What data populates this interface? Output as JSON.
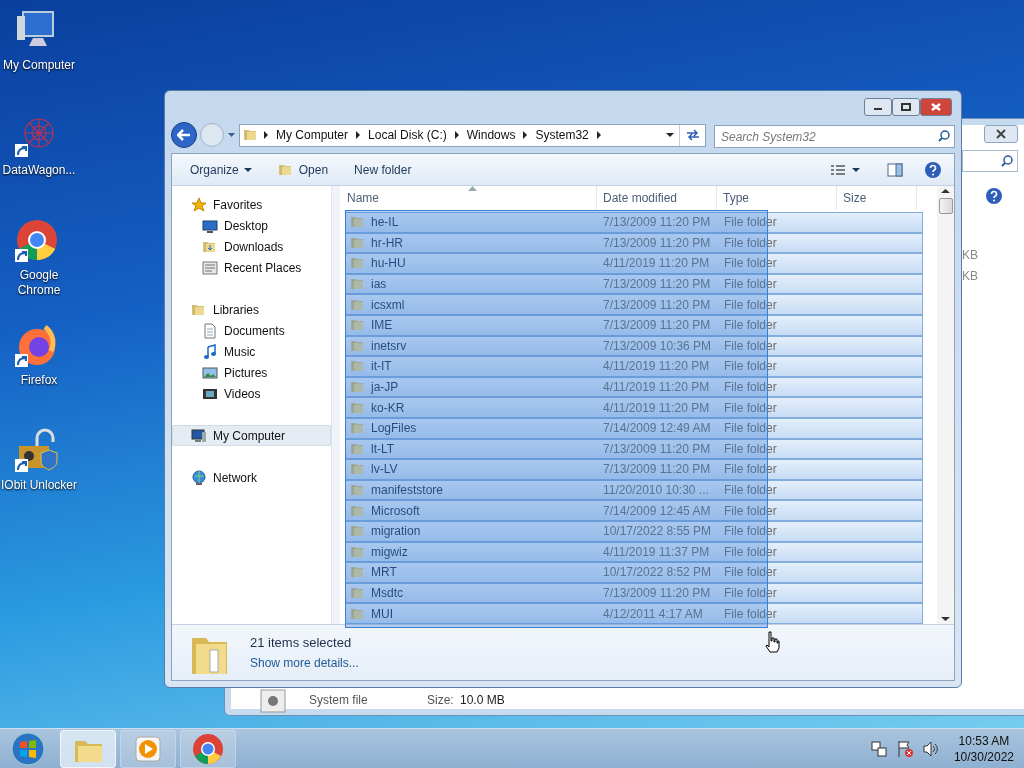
{
  "desktop_icons": [
    {
      "label": "My Computer",
      "kind": "computer",
      "shortcut": false
    },
    {
      "label": "DataWagon...",
      "kind": "web",
      "shortcut": true
    },
    {
      "label": "Google Chrome",
      "kind": "chrome",
      "shortcut": true
    },
    {
      "label": "Firefox",
      "kind": "firefox",
      "shortcut": true
    },
    {
      "label": "IObit Unlocker",
      "kind": "unlock",
      "shortcut": true
    }
  ],
  "background_window": {
    "side_texts": [
      "KB",
      "KB"
    ],
    "file_type": "System file",
    "size_label": "Size:",
    "size_value": "10.0 MB"
  },
  "window": {
    "address": [
      "My Computer",
      "Local Disk (C:)",
      "Windows",
      "System32"
    ],
    "search": {
      "placeholder": "Search System32"
    },
    "toolbar": [
      {
        "label": "Organize",
        "kind": "menu"
      },
      {
        "label": "Open",
        "kind": "open"
      },
      {
        "label": "New folder",
        "kind": "plain"
      }
    ],
    "nav": [
      {
        "label": "Favorites",
        "kind": "star",
        "selected": false,
        "children": [
          {
            "label": "Desktop",
            "kind": "desktop",
            "selected": false
          },
          {
            "label": "Downloads",
            "kind": "downloads",
            "selected": false
          },
          {
            "label": "Recent Places",
            "kind": "recent",
            "selected": false
          }
        ]
      },
      {
        "label": "Libraries",
        "kind": "library",
        "selected": false,
        "children": [
          {
            "label": "Documents",
            "kind": "documents",
            "selected": false
          },
          {
            "label": "Music",
            "kind": "music",
            "selected": false
          },
          {
            "label": "Pictures",
            "kind": "pictures",
            "selected": false
          },
          {
            "label": "Videos",
            "kind": "videos",
            "selected": false
          }
        ]
      },
      {
        "label": "My Computer",
        "kind": "computer",
        "selected": true
      },
      {
        "label": "Network",
        "kind": "network",
        "selected": false
      }
    ],
    "columns": [
      "Name",
      "Date modified",
      "Type",
      "Size"
    ],
    "rows": [
      {
        "name": "he-IL",
        "date": "7/13/2009 11:20 PM",
        "type": "File folder",
        "selected": true
      },
      {
        "name": "hr-HR",
        "date": "7/13/2009 11:20 PM",
        "type": "File folder",
        "selected": true
      },
      {
        "name": "hu-HU",
        "date": "4/11/2019 11:20 PM",
        "type": "File folder",
        "selected": true
      },
      {
        "name": "ias",
        "date": "7/13/2009 11:20 PM",
        "type": "File folder",
        "selected": true
      },
      {
        "name": "icsxml",
        "date": "7/13/2009 11:20 PM",
        "type": "File folder",
        "selected": true
      },
      {
        "name": "IME",
        "date": "7/13/2009 11:20 PM",
        "type": "File folder",
        "selected": true
      },
      {
        "name": "inetsrv",
        "date": "7/13/2009 10:36 PM",
        "type": "File folder",
        "selected": true
      },
      {
        "name": "it-IT",
        "date": "4/11/2019 11:20 PM",
        "type": "File folder",
        "selected": true
      },
      {
        "name": "ja-JP",
        "date": "4/11/2019 11:20 PM",
        "type": "File folder",
        "selected": true
      },
      {
        "name": "ko-KR",
        "date": "4/11/2019 11:20 PM",
        "type": "File folder",
        "selected": true
      },
      {
        "name": "LogFiles",
        "date": "7/14/2009 12:49 AM",
        "type": "File folder",
        "selected": true
      },
      {
        "name": "lt-LT",
        "date": "7/13/2009 11:20 PM",
        "type": "File folder",
        "selected": true
      },
      {
        "name": "lv-LV",
        "date": "7/13/2009 11:20 PM",
        "type": "File folder",
        "selected": true
      },
      {
        "name": "manifeststore",
        "date": "11/20/2010 10:30 ...",
        "type": "File folder",
        "selected": true
      },
      {
        "name": "Microsoft",
        "date": "7/14/2009 12:45 AM",
        "type": "File folder",
        "selected": true
      },
      {
        "name": "migration",
        "date": "10/17/2022 8:55 PM",
        "type": "File folder",
        "selected": true
      },
      {
        "name": "migwiz",
        "date": "4/11/2019 11:37 PM",
        "type": "File folder",
        "selected": true
      },
      {
        "name": "MRT",
        "date": "10/17/2022 8:52 PM",
        "type": "File folder",
        "selected": true
      },
      {
        "name": "Msdtc",
        "date": "7/13/2009 11:20 PM",
        "type": "File folder",
        "selected": true
      },
      {
        "name": "MUI",
        "date": "4/12/2011 4:17 AM",
        "type": "File folder",
        "selected": true
      }
    ],
    "details": {
      "count": "21 items selected",
      "link": "Show more details..."
    }
  },
  "taskbar": {
    "apps": [
      {
        "kind": "explorer",
        "selected": true
      },
      {
        "kind": "media",
        "selected": false
      },
      {
        "kind": "chrome",
        "selected": false
      }
    ],
    "time": "10:53 AM",
    "date": "10/30/2022"
  }
}
